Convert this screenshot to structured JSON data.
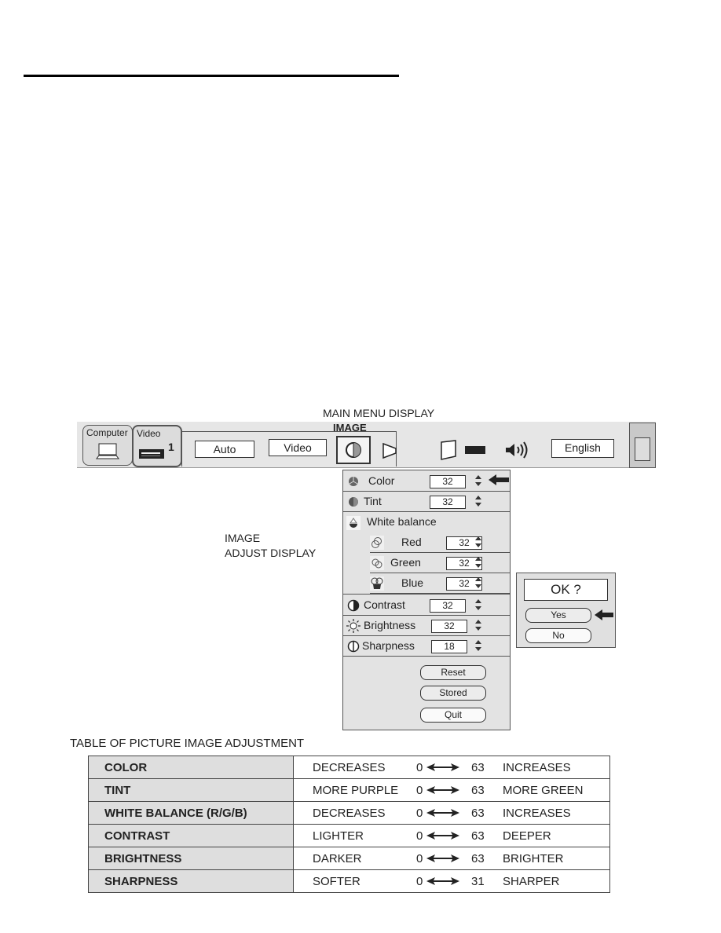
{
  "main_menu": {
    "caption": "MAIN MENU DISPLAY",
    "image_label": "IMAGE",
    "tabs": [
      {
        "label": "Computer",
        "icon": "laptop-icon"
      },
      {
        "label": "Video",
        "number": "1",
        "icon": "vcr-icon"
      }
    ],
    "buttons": {
      "auto": "Auto",
      "video": "Video",
      "language": "English"
    },
    "icons": [
      "image-adjust-icon",
      "screen-icon",
      "keystone-icon",
      "projector-icon",
      "speaker-icon",
      "exit-icon"
    ]
  },
  "image_adjust": {
    "caption_line1": "IMAGE",
    "caption_line2": "ADJUST DISPLAY",
    "rows": [
      {
        "label": "Color",
        "value": "32",
        "icon": "color-icon"
      },
      {
        "label": "Tint",
        "value": "32",
        "icon": "tint-icon"
      },
      {
        "label": "White balance",
        "icon": "white-balance-icon"
      },
      {
        "label": "Red",
        "value": "32",
        "icon": "red-icon"
      },
      {
        "label": "Green",
        "value": "32",
        "icon": "green-icon"
      },
      {
        "label": "Blue",
        "value": "32",
        "icon": "blue-icon"
      },
      {
        "label": "Contrast",
        "value": "32",
        "icon": "contrast-icon"
      },
      {
        "label": "Brightness",
        "value": "32",
        "icon": "brightness-icon"
      },
      {
        "label": "Sharpness",
        "value": "18",
        "icon": "sharpness-icon"
      }
    ],
    "buttons": {
      "reset": "Reset",
      "stored": "Stored",
      "quit": "Quit"
    }
  },
  "confirm_dialog": {
    "title": "OK ?",
    "yes": "Yes",
    "no": "No"
  },
  "table": {
    "title": "TABLE OF PICTURE IMAGE ADJUSTMENT",
    "rows": [
      {
        "name": "COLOR",
        "low": "DECREASES",
        "min": "0",
        "max": "63",
        "high": "INCREASES"
      },
      {
        "name": "TINT",
        "low": "MORE PURPLE",
        "min": "0",
        "max": "63",
        "high": "MORE GREEN"
      },
      {
        "name": "WHITE BALANCE (R/G/B)",
        "low": "DECREASES",
        "min": "0",
        "max": "63",
        "high": "INCREASES"
      },
      {
        "name": "CONTRAST",
        "low": "LIGHTER",
        "min": "0",
        "max": "63",
        "high": "DEEPER"
      },
      {
        "name": "BRIGHTNESS",
        "low": "DARKER",
        "min": "0",
        "max": "63",
        "high": "BRIGHTER"
      },
      {
        "name": "SHARPNESS",
        "low": "SOFTER",
        "min": "0",
        "max": "31",
        "high": "SHARPER"
      }
    ]
  }
}
